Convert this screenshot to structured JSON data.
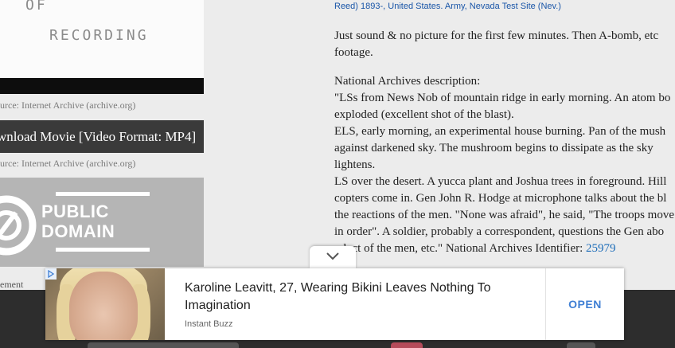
{
  "left_column": {
    "video_frame": {
      "line1": "OF",
      "line2": "RECORDING"
    },
    "source_note_1": "urce: Internet Archive (archive.org)",
    "download_button": "wnload Movie [Video Format: MP4]",
    "source_note_2": "urce: Internet Archive (archive.org)",
    "license_badge": {
      "line1": "PUBLIC",
      "line2": "DOMAIN"
    },
    "advertisement_label": "ement"
  },
  "right_column": {
    "tags": [
      "Reed) 1893-",
      "United States. Army",
      "Nevada Test Site (Nev.)"
    ],
    "intro": [
      "Just sound & no picture for the first few minutes. Then A-bomb, etc",
      "footage."
    ],
    "description": {
      "heading": "National Archives description:",
      "lines": [
        "\"LSs from News Nob of mountain ridge in early morning. An atom bo",
        "exploded (excellent shot of the blast).",
        "ELS, early morning, an experimental house burning. Pan of the mush",
        "against darkened sky. The mushroom begins to dissipate as the sky",
        "lightens.",
        "LS over the desert. A yucca plant and Joshua trees in foreground. Hill",
        "copters come in. Gen John R. Hodge at microphone talks about the bl",
        "the reactions of the men. \"None was afraid\", he said, \"The troops move",
        "in order\". A soldier, probably a correspondent, questions the Gen abo",
        "nduct of the men, etc.\" National Archives  Identifier: "
      ],
      "identifier": "25979"
    }
  },
  "ad": {
    "headline": "Karoline Leavitt, 27, Wearing Bikini Leaves Nothing To Imagination",
    "source": "Instant Buzz",
    "cta": "OPEN",
    "collapse_icon": "chevron-down-icon",
    "adchoices_icon": "adchoices-icon"
  },
  "colors": {
    "link": "#1a6bb8",
    "cta": "#3f7fd4",
    "download_bg": "#3a3a3a",
    "bottom_bar": "#2d2d2d"
  }
}
